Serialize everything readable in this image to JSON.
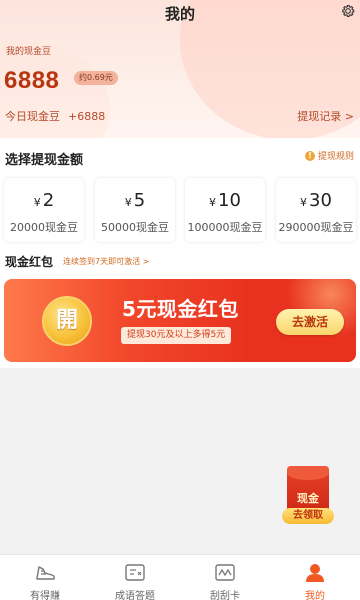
{
  "header": {
    "title": "我的",
    "settings_icon": "gear-icon"
  },
  "balance": {
    "label": "我的现金豆",
    "value": "6888",
    "approx": "约0.69元",
    "today_label": "今日现金豆",
    "today_value": "+6888",
    "record_link": "提现记录 >"
  },
  "withdraw": {
    "section_title": "选择提现金额",
    "rules_label": "提现规则",
    "options": [
      {
        "currency": "¥",
        "amount": "2",
        "beans": "20000现金豆"
      },
      {
        "currency": "¥",
        "amount": "5",
        "beans": "50000现金豆"
      },
      {
        "currency": "¥",
        "amount": "10",
        "beans": "100000现金豆"
      },
      {
        "currency": "¥",
        "amount": "30",
        "beans": "290000现金豆"
      }
    ]
  },
  "redpacket": {
    "section_title": "现金红包",
    "hint": "连续签到7天即可激活 >",
    "coin_char": "開",
    "title": "5元现金红包",
    "subtitle": "提现30元及以上多得5元",
    "button": "去激活"
  },
  "floating": {
    "title": "现金",
    "button": "去领取"
  },
  "tabbar": {
    "tabs": [
      {
        "label": "有得赚",
        "icon": "sneaker-icon",
        "active": false
      },
      {
        "label": "成语答题",
        "icon": "idiom-card-icon",
        "active": false
      },
      {
        "label": "刮刮卡",
        "icon": "scratch-card-icon",
        "active": false
      },
      {
        "label": "我的",
        "icon": "user-icon",
        "active": true
      }
    ],
    "active_color": "#f05a22",
    "inactive_color": "#666666"
  },
  "colors": {
    "accent": "#b8360f",
    "banner_red": "#e8321f",
    "gold": "#f8c23a"
  }
}
